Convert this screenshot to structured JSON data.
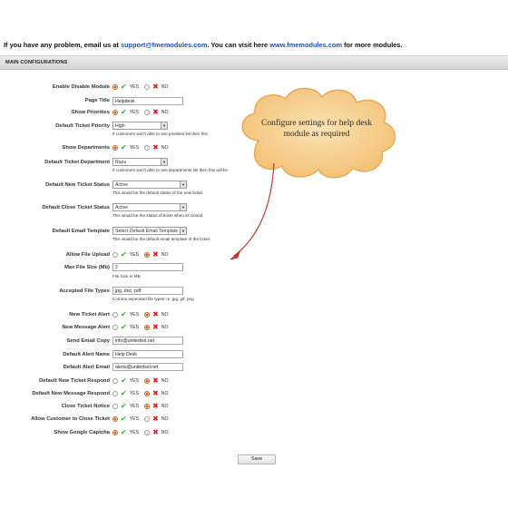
{
  "notice": {
    "prefix": "If you have any problem, email us at ",
    "email": "support@fmemodules.com",
    "middle": ". You can visit here ",
    "site": "www.fmemodules.com",
    "suffix": " for more modules."
  },
  "section": {
    "title": "MAIN CONFIGURATIONS"
  },
  "options": {
    "yes": "YES",
    "no": "NO"
  },
  "fields": {
    "enable_disable_module": {
      "label": "Enable Disable Module",
      "selected": "yes"
    },
    "page_title": {
      "label": "Page Title",
      "value": "Helpdesk"
    },
    "show_priorities": {
      "label": "Show Priorities",
      "selected": "yes"
    },
    "default_ticket_priority": {
      "label": "Default Ticket Priority",
      "value": "High",
      "help": "If customers won't able to see priorities list then this"
    },
    "show_departments": {
      "label": "Show Departments",
      "selected": "yes"
    },
    "default_ticket_department": {
      "label": "Default Ticket Department",
      "value": "Raza",
      "help": "If customers won't able to see departments list then this will be"
    },
    "default_new_ticket_status": {
      "label": "Default New Ticket Status",
      "value": "Active",
      "help": "This would be the default status of the new ticket."
    },
    "default_close_ticket_status": {
      "label": "Default Close Ticket Status",
      "value": "Active",
      "help": "This would be the status of ticket when its closed."
    },
    "default_email_template": {
      "label": "Default Email Template",
      "value": "Select Default Email Template",
      "help": "This would be the default email template of the ticket."
    },
    "allow_file_upload": {
      "label": "Allow File Upload",
      "selected": "yes"
    },
    "max_file_size": {
      "label": "Max File Size (Mb)",
      "value": "2",
      "help": "File Size in MB"
    },
    "accepted_file_types": {
      "label": "Accepted File Types",
      "value": "jpg, doc, pdf",
      "help": "Comma seperated file types i.e. jpg, gif, png"
    },
    "new_ticket_alert": {
      "label": "New Ticket Alert",
      "selected": "no"
    },
    "new_message_alert": {
      "label": "New Message Alert",
      "selected": "no"
    },
    "send_email_copy": {
      "label": "Send Email Copy",
      "value": "info@unitedsol.net"
    },
    "default_alert_name": {
      "label": "Default Alert Name",
      "value": "Help Desk"
    },
    "default_alert_email": {
      "label": "Default Alert Email",
      "value": "alerts@unitedsol.net"
    },
    "default_new_ticket_respond": {
      "label": "Default New Ticket Respond",
      "selected": "no"
    },
    "default_new_message_respond": {
      "label": "Default New Message Respond",
      "selected": "no"
    },
    "close_ticket_notice": {
      "label": "Close Ticket Notice",
      "selected": "no"
    },
    "allow_customer_to_close_ticket": {
      "label": "Allow Customer to Close Ticket",
      "selected": "yes"
    },
    "show_google_captcha": {
      "label": "Show Google Captcha",
      "selected": "yes"
    }
  },
  "callout": {
    "text": "Configure settings for help desk module as required"
  },
  "save_label": "Save",
  "colors": {
    "link": "#1f4fb6",
    "check": "#39a845",
    "cross": "#d62020",
    "cloud_fill": "#f5c680",
    "arrow": "#c0392b"
  },
  "icons": {
    "yes": "check-icon",
    "no": "cross-icon"
  }
}
